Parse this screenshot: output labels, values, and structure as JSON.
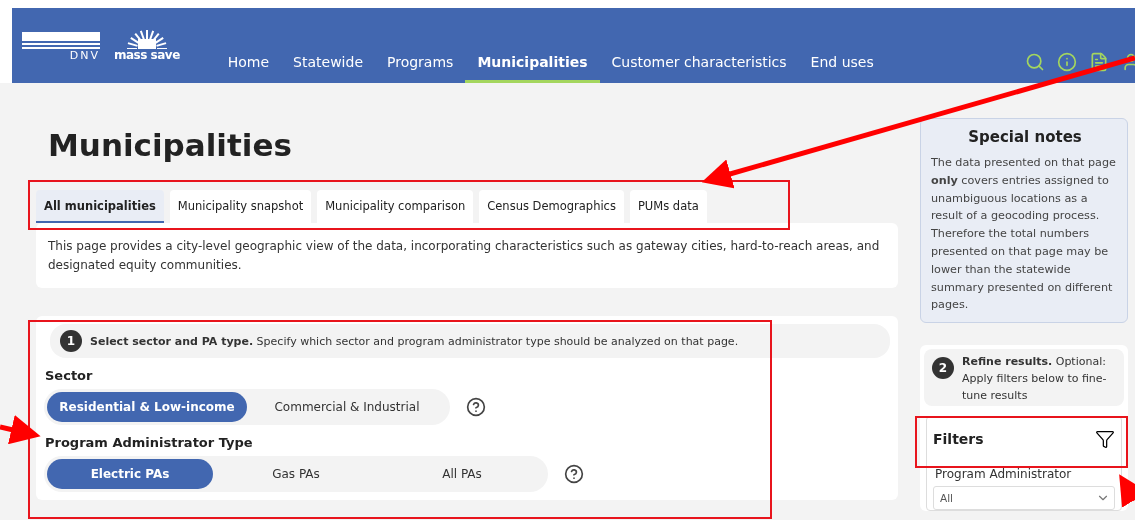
{
  "header": {
    "logos": [
      "DNV",
      "mass save"
    ],
    "nav": [
      {
        "label": "Home",
        "selected": false
      },
      {
        "label": "Statewide",
        "selected": false
      },
      {
        "label": "Programs",
        "selected": false
      },
      {
        "label": "Municipalities",
        "selected": true
      },
      {
        "label": "Customer characteristics",
        "selected": false
      },
      {
        "label": "End uses",
        "selected": false
      }
    ]
  },
  "page_title": "Municipalities",
  "tabs": [
    {
      "label": "All municipalities",
      "selected": true
    },
    {
      "label": "Municipality snapshot",
      "selected": false
    },
    {
      "label": "Municipality comparison",
      "selected": false
    },
    {
      "label": "Census Demographics",
      "selected": false
    },
    {
      "label": "PUMs data",
      "selected": false
    }
  ],
  "description": "This page provides a city-level geographic view of the data, incorporating characteristics such as gateway cities, hard-to-reach areas, and designated equity communities.",
  "step_1": {
    "number": "1",
    "text": "**Select sector and PA type.** Specify which sector and program administrator type should be analyzed on that page.",
    "groups": [
      {
        "label": "Sector",
        "options": [
          {
            "label": "Residential & Low-income",
            "selected": true
          },
          {
            "label": "Commercial & Industrial",
            "selected": false
          }
        ]
      },
      {
        "label": "Program Administrator Type",
        "options": [
          {
            "label": "Electric PAs",
            "selected": true
          },
          {
            "label": "Gas PAs",
            "selected": false
          },
          {
            "label": "All PAs",
            "selected": false
          }
        ]
      }
    ]
  },
  "special_notes": {
    "title": "Special notes",
    "text": "The data presented on that page **only** covers entries assigned to unambiguous locations as a result of a geocoding process. Therefore the total numbers presented on that page may be lower than the statewide summary presented on different pages."
  },
  "step_2": {
    "number": "2",
    "text": "**Refine results.** Optional: Apply filters below to fine-tune results"
  },
  "filters": {
    "title": "Filters",
    "fields": [
      {
        "label": "Program Administrator",
        "value": "All"
      }
    ]
  }
}
